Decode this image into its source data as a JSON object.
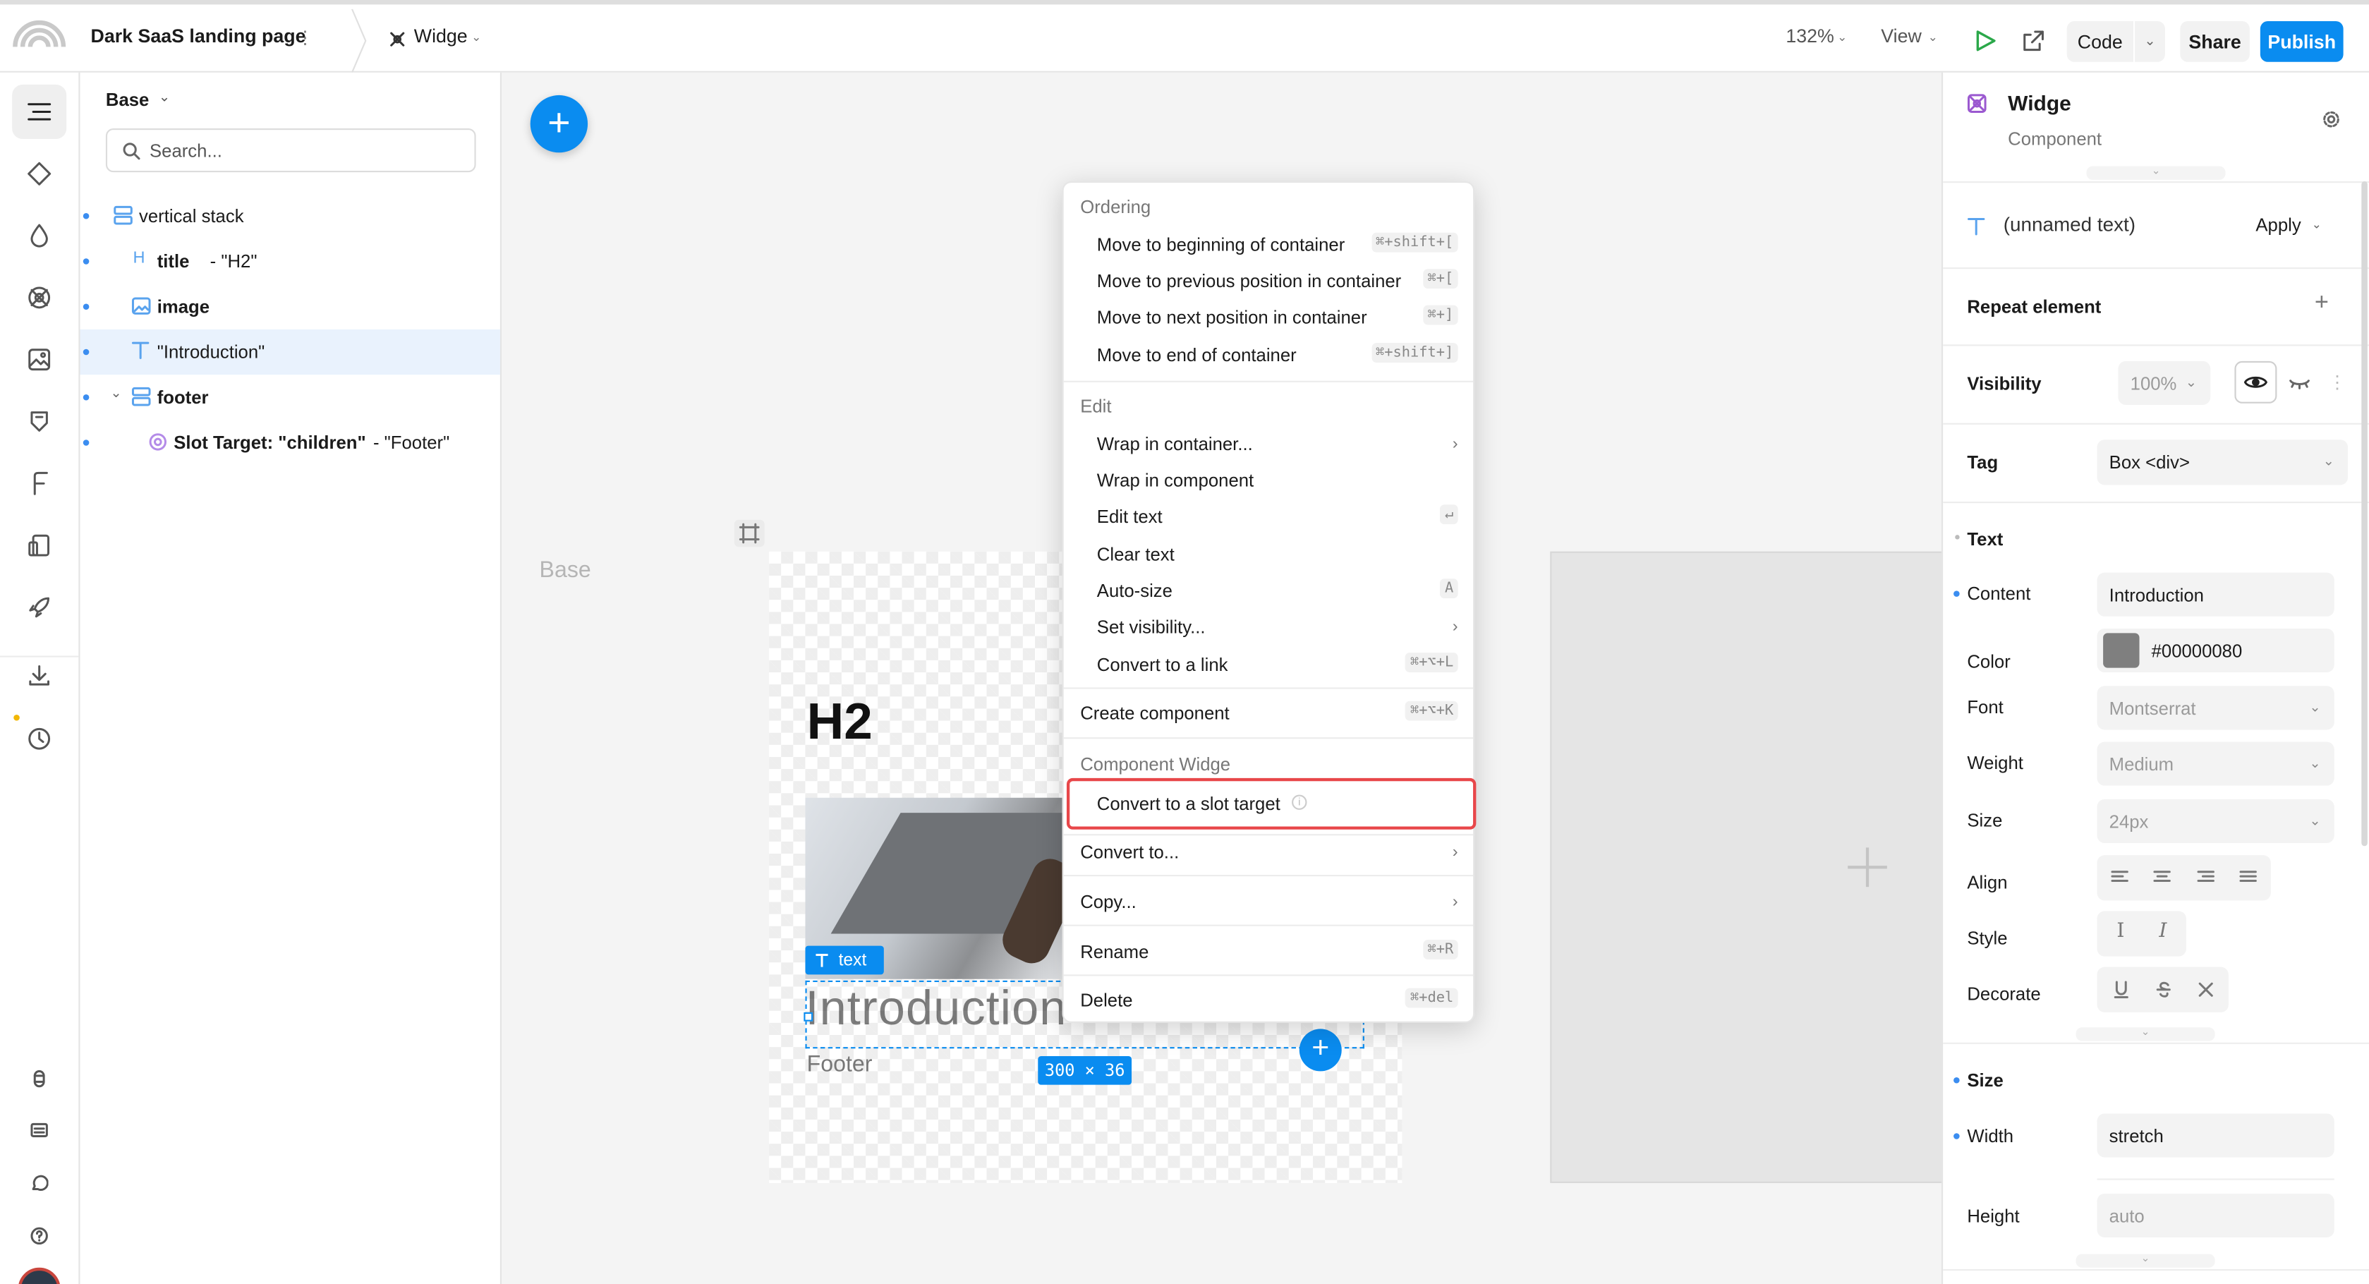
{
  "topbar": {
    "project_title": "Dark SaaS landing page",
    "component_name": "Widge",
    "zoom": "132%",
    "view_label": "View",
    "code_label": "Code",
    "share_label": "Share",
    "publish_label": "Publish"
  },
  "tree": {
    "arena_label": "Base",
    "search_placeholder": "Search...",
    "items": [
      {
        "label": "vertical stack",
        "suffix": ""
      },
      {
        "label": "title",
        "suffix": "- \"H2\""
      },
      {
        "label": "image",
        "suffix": ""
      },
      {
        "label": "\"Introduction\"",
        "suffix": ""
      },
      {
        "label": "footer",
        "suffix": ""
      },
      {
        "label": "Slot Target: \"children\"",
        "suffix": "- \"Footer\""
      }
    ]
  },
  "canvas": {
    "frame_label": "Base",
    "heading": "H2",
    "text_badge": "text",
    "intro_text": "Introduction",
    "footer_text": "Footer",
    "size_badge": "300 × 36"
  },
  "context_menu": {
    "sections": {
      "ordering": "Ordering",
      "edit": "Edit",
      "component": "Component Widge"
    },
    "ordering_items": [
      {
        "label": "Move to beginning of container",
        "shortcut": "⌘+shift+["
      },
      {
        "label": "Move to previous position in container",
        "shortcut": "⌘+["
      },
      {
        "label": "Move to next position in container",
        "shortcut": "⌘+]"
      },
      {
        "label": "Move to end of container",
        "shortcut": "⌘+shift+]"
      }
    ],
    "edit_items": [
      {
        "label": "Wrap in container...",
        "shortcut": ""
      },
      {
        "label": "Wrap in component",
        "shortcut": ""
      },
      {
        "label": "Edit text",
        "shortcut": "↵"
      },
      {
        "label": "Clear text",
        "shortcut": ""
      },
      {
        "label": "Auto-size",
        "shortcut": "A"
      },
      {
        "label": "Set visibility...",
        "shortcut": ""
      },
      {
        "label": "Convert to a link",
        "shortcut": "⌘+⌥+L"
      }
    ],
    "create_component": {
      "label": "Create component",
      "shortcut": "⌘+⌥+K"
    },
    "slot_target": {
      "label": "Convert to a slot target"
    },
    "convert_to": {
      "label": "Convert to..."
    },
    "copy": {
      "label": "Copy..."
    },
    "rename": {
      "label": "Rename",
      "shortcut": "⌘+R"
    },
    "delete": {
      "label": "Delete",
      "shortcut": "⌘+del"
    }
  },
  "props": {
    "component_title": "Widge",
    "component_subtitle": "Component",
    "text_element": "(unnamed text)",
    "apply_label": "Apply",
    "repeat_label": "Repeat element",
    "visibility_label": "Visibility",
    "visibility_value": "100%",
    "tag_label": "Tag",
    "tag_value": "Box <div>",
    "text_section": "Text",
    "content_label": "Content",
    "content_value": "Introduction",
    "color_label": "Color",
    "color_value": "#00000080",
    "font_label": "Font",
    "font_value": "Montserrat",
    "weight_label": "Weight",
    "weight_value": "Medium",
    "size_label": "Size",
    "size_value": "24px",
    "align_label": "Align",
    "style_label": "Style",
    "decorate_label": "Decorate",
    "size_section": "Size",
    "width_label": "Width",
    "width_value": "stretch",
    "height_label": "Height",
    "height_value": "auto"
  },
  "colors": {
    "accent": "#0a8cf0",
    "highlight": "#e8474a",
    "selection": "#e9f2fd"
  }
}
